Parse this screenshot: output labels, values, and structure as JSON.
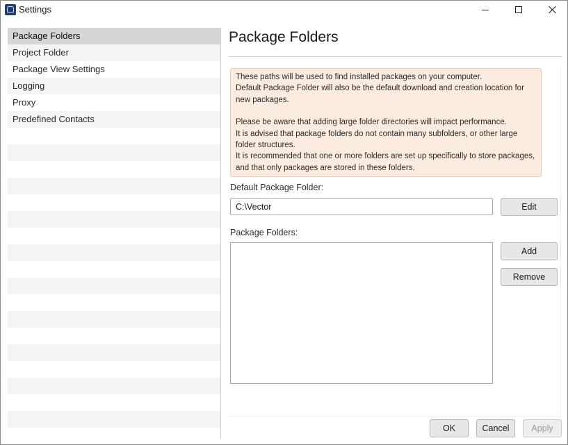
{
  "window": {
    "title": "Settings",
    "icon": "app-logo-icon"
  },
  "sidebar": {
    "items": [
      {
        "label": "Package Folders",
        "selected": true
      },
      {
        "label": "Project Folder",
        "selected": false
      },
      {
        "label": "Package View Settings",
        "selected": false
      },
      {
        "label": "Logging",
        "selected": false
      },
      {
        "label": "Proxy",
        "selected": false
      },
      {
        "label": "Predefined Contacts",
        "selected": false
      }
    ]
  },
  "main": {
    "title": "Package Folders",
    "info": {
      "line1": "These paths will be used to find installed packages on your computer.",
      "line2": "Default Package Folder will also be the default download and creation location for new packages.",
      "line3": "Please be aware that adding large folder directories will impact performance.",
      "line4": "It is advised that package folders do not contain many subfolders, or other large folder structures.",
      "line5": "It is recommended that one or more folders are set up specifically to store packages, and that only packages are stored in these folders."
    },
    "default_folder_label": "Default Package Folder:",
    "default_folder_value": "C:\\Vector",
    "edit_label": "Edit",
    "package_folders_label": "Package Folders:",
    "add_label": "Add",
    "remove_label": "Remove"
  },
  "footer": {
    "ok_label": "OK",
    "cancel_label": "Cancel",
    "apply_label": "Apply",
    "apply_enabled": false
  },
  "colors": {
    "info_background": "#fcebdf",
    "selected_row": "#d6d6d6",
    "button_background": "#e7e7e7"
  }
}
